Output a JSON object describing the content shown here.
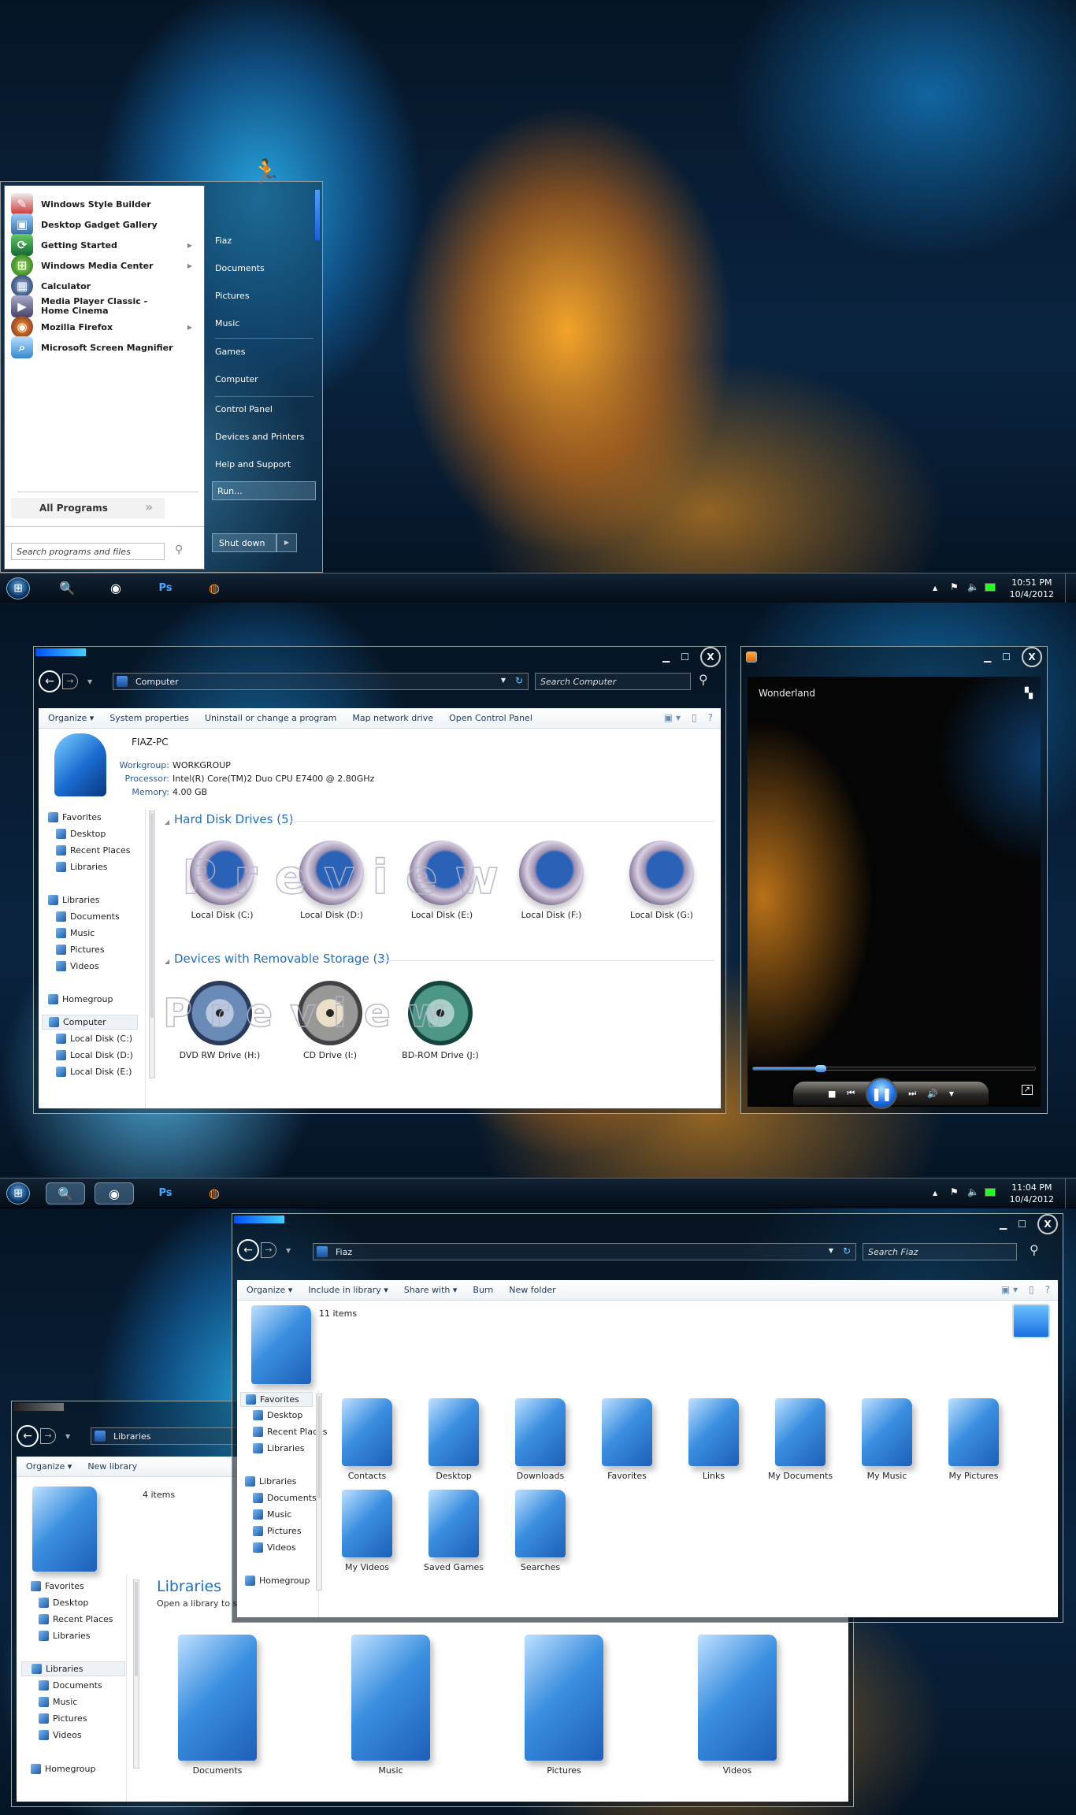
{
  "screens": [
    {
      "taskbar": {
        "time": "10:51 PM",
        "date": "10/4/2012"
      },
      "start_menu": {
        "programs": [
          {
            "label": "Windows Style Builder",
            "icon": "brush-wrench-icon",
            "submenu": false
          },
          {
            "label": "Desktop Gadget Gallery",
            "icon": "gadget-gallery-icon",
            "submenu": false
          },
          {
            "label": "Getting Started",
            "icon": "getting-started-icon",
            "submenu": true
          },
          {
            "label": "Windows Media Center",
            "icon": "media-center-icon",
            "submenu": true
          },
          {
            "label": "Calculator",
            "icon": "calculator-icon",
            "submenu": false
          },
          {
            "label": "Media Player Classic - Home Cinema",
            "icon": "mpc-icon",
            "submenu": false
          },
          {
            "label": "Mozilla Firefox",
            "icon": "firefox-icon",
            "submenu": true
          },
          {
            "label": "Microsoft Screen Magnifier",
            "icon": "magnifier-icon",
            "submenu": false
          }
        ],
        "all_programs": "All Programs",
        "search_placeholder": "Search programs and files",
        "right_links": [
          "Fiaz",
          "Documents",
          "Pictures",
          "Music",
          "Games",
          "Computer",
          "Control Panel",
          "Devices and Printers",
          "Help and Support"
        ],
        "run": "Run...",
        "shutdown": "Shut down"
      }
    },
    {
      "taskbar": {
        "time": "11:04 PM",
        "date": "10/4/2012"
      }
    }
  ],
  "computer_window": {
    "address": "Computer",
    "search_placeholder": "Search Computer",
    "commands": [
      "Organize ▾",
      "System properties",
      "Uninstall or change a program",
      "Map network drive",
      "Open Control Panel"
    ],
    "pc_name": "FIAZ-PC",
    "details": [
      {
        "key": "Workgroup:",
        "value": "WORKGROUP"
      },
      {
        "key": "Processor:",
        "value": "Intel(R) Core(TM)2 Duo CPU    E7400  @ 2.80GHz"
      },
      {
        "key": "Memory:",
        "value": "4.00 GB"
      }
    ],
    "nav": [
      "Favorites",
      "Desktop",
      "Recent Places",
      "Libraries",
      "Libraries",
      "Documents",
      "Music",
      "Pictures",
      "Videos",
      "Homegroup",
      "Computer",
      "Local Disk (C:)",
      "Local Disk (D:)",
      "Local Disk (E:)"
    ],
    "groups": [
      {
        "title": "Hard Disk Drives (5)",
        "items": [
          "Local Disk (C:)",
          "Local Disk (D:)",
          "Local Disk (E:)",
          "Local Disk (F:)",
          "Local Disk (G:)"
        ]
      },
      {
        "title": "Devices with Removable Storage (3)",
        "items": [
          "DVD RW Drive (H:)",
          "CD Drive (I:)",
          "BD-ROM Drive (J:)"
        ]
      }
    ],
    "watermark": "Preview"
  },
  "media_player": {
    "title": "Wonderland",
    "seek_fraction": 0.24
  },
  "fiaz_window": {
    "address": "Fiaz",
    "search_placeholder": "Search Fiaz",
    "commands": [
      "Organize ▾",
      "Include in library ▾",
      "Share with ▾",
      "Burn",
      "New folder"
    ],
    "item_count": "11 items",
    "nav": [
      "Favorites",
      "Desktop",
      "Recent Places",
      "Libraries",
      "Libraries",
      "Documents",
      "Music",
      "Pictures",
      "Videos",
      "Homegroup"
    ],
    "items": [
      "Contacts",
      "Desktop",
      "Downloads",
      "Favorites",
      "Links",
      "My Documents",
      "My Music",
      "My Pictures",
      "My Videos",
      "Saved Games",
      "Searches"
    ]
  },
  "libraries_window": {
    "address": "Libraries",
    "commands": [
      "Organize ▾",
      "New library"
    ],
    "item_count": "4 items",
    "heading": "Libraries",
    "subheading": "Open a library to see your files",
    "nav": [
      "Favorites",
      "Desktop",
      "Recent Places",
      "Libraries",
      "Libraries",
      "Documents",
      "Music",
      "Pictures",
      "Videos",
      "Homegroup"
    ],
    "items": [
      "Documents",
      "Music",
      "Pictures",
      "Videos"
    ]
  }
}
